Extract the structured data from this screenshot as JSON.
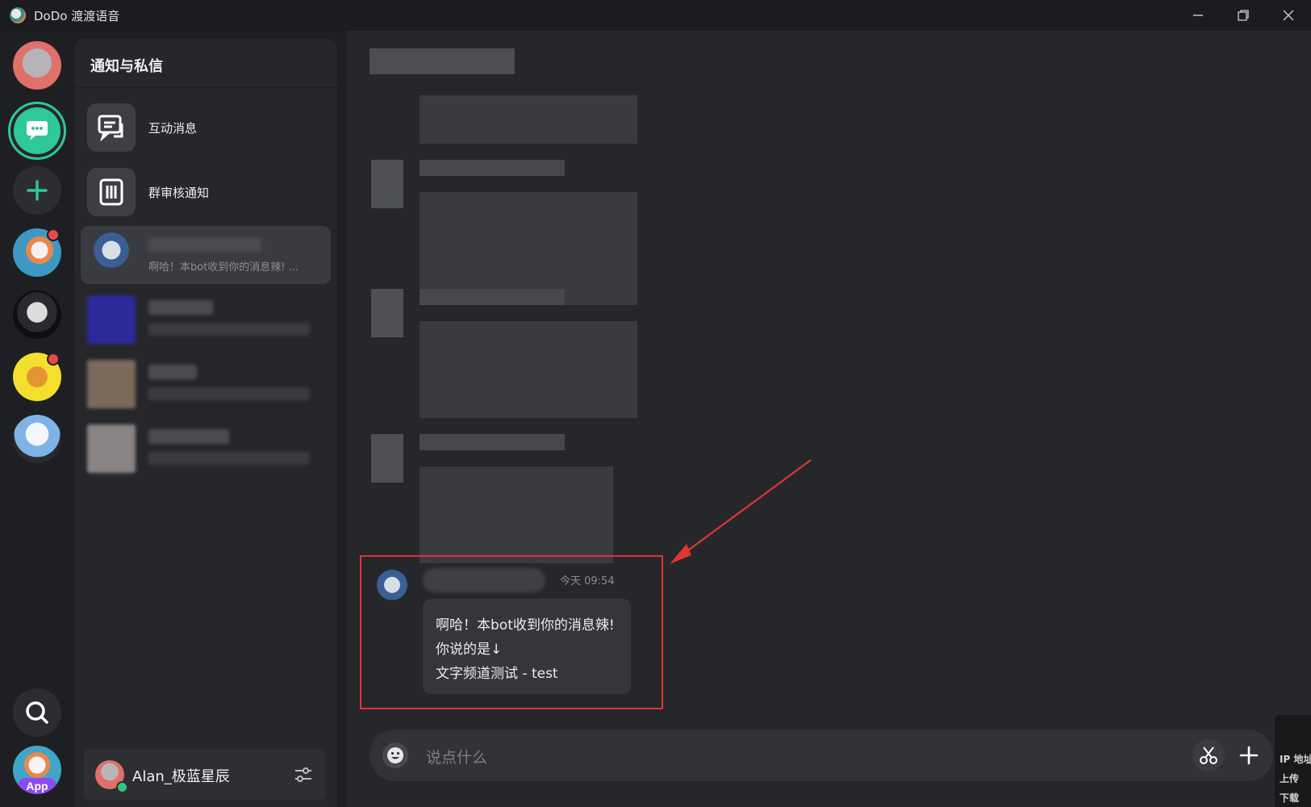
{
  "window": {
    "title": "DoDo 渡渡语音",
    "controls": {
      "minimize_icon": "minimize-icon",
      "maximize_icon": "maximize-icon",
      "close_icon": "close-icon"
    }
  },
  "server_rail": {
    "items": [
      "user-avatar",
      "messages",
      "add-server",
      "server-duck",
      "server-dark",
      "server-beer",
      "server-anime"
    ],
    "search_icon": "search-icon",
    "app_label": "App"
  },
  "dm_panel": {
    "title": "通知与私信",
    "items": [
      {
        "label": "互动消息",
        "icon": "chat-bubbles-icon"
      },
      {
        "label": "群审核通知",
        "icon": "notebook-icon"
      }
    ],
    "active_conversation": {
      "preview": "啊哈！本bot收到你的消息辣! ..."
    }
  },
  "user_bar": {
    "name": "Alan_极蓝星辰",
    "status_color": "#31c28a"
  },
  "chat": {
    "last_message": {
      "time": "今天 09:54",
      "lines": [
        "啊哈！本bot收到你的消息辣!",
        "你说的是↓",
        " 文字频道测试 - test"
      ]
    },
    "input_placeholder": "说点什么",
    "highlight_color": "#e23434"
  },
  "side_overlay": {
    "lines": [
      "IP 地址",
      "上传",
      "下载"
    ]
  },
  "colors": {
    "accent": "#2fc89a",
    "bg": "#1e1f22",
    "panel": "#26272b"
  }
}
